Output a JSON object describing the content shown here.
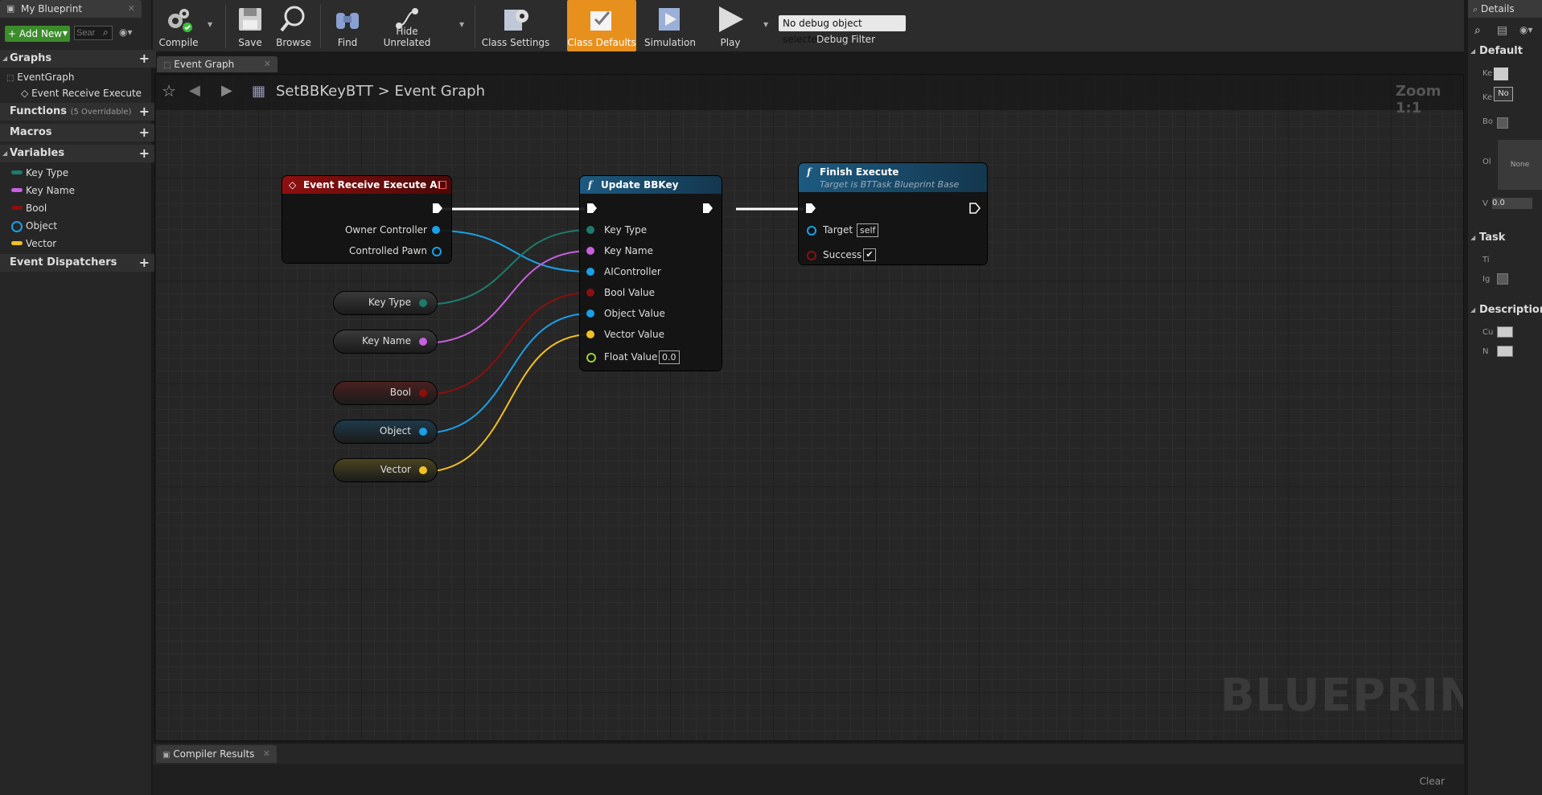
{
  "left_panel": {
    "tab_label": "My Blueprint",
    "add_new_label": "Add New",
    "search_placeholder": "Sear",
    "sections": {
      "graphs": "Graphs",
      "functions": "Functions",
      "functions_count": "(5 Overridable)",
      "macros": "Macros",
      "variables": "Variables",
      "event_dispatchers": "Event Dispatchers"
    },
    "graph_items": [
      "EventGraph",
      "Event Receive Execute"
    ],
    "variables": [
      {
        "name": "Key Type",
        "color": "#1f7a6c"
      },
      {
        "name": "Key Name",
        "color": "#c860e0"
      },
      {
        "name": "Bool",
        "color": "#8c0f0f"
      },
      {
        "name": "Object",
        "color": "#1aa0e6"
      },
      {
        "name": "Vector",
        "color": "#f2c020"
      }
    ]
  },
  "toolbar": {
    "compile": "Compile",
    "save": "Save",
    "browse": "Browse",
    "find": "Find",
    "hide_unrelated": "Hide Unrelated",
    "class_settings": "Class Settings",
    "class_defaults": "Class Defaults",
    "simulation": "Simulation",
    "play": "Play",
    "debug_select": "No debug object selected",
    "debug_filter": "Debug Filter"
  },
  "graph": {
    "tab_label": "Event Graph",
    "breadcrumb_root": "SetBBKeyBTT",
    "breadcrumb_current": "Event Graph",
    "zoom": "Zoom 1:1",
    "watermark": "BLUEPRINT"
  },
  "nodes": {
    "event": {
      "title": "Event Receive Execute AI",
      "pins": [
        "Owner Controller",
        "Controlled Pawn"
      ]
    },
    "update": {
      "title": "Update BBKey",
      "pins": [
        "Key Type",
        "Key Name",
        "AIController",
        "Bool Value",
        "Object Value",
        "Vector Value",
        "Float Value"
      ],
      "float_default": "0.0"
    },
    "finish": {
      "title": "Finish Execute",
      "subtitle": "Target is BTTask Blueprint Base",
      "target": "Target",
      "target_default": "self",
      "success": "Success"
    },
    "var_getters": [
      "Key Type",
      "Key Name",
      "Bool",
      "Object",
      "Vector"
    ]
  },
  "bottom": {
    "tab_label": "Compiler Results",
    "clear": "Clear"
  },
  "details": {
    "tab_label": "Details",
    "sections": [
      "Default",
      "Task",
      "Description"
    ],
    "row_labels": [
      "Ke",
      "Ke",
      "Bo",
      "Ol",
      "V",
      "Ti",
      "Ig",
      "Cu",
      "N"
    ],
    "no_label": "No",
    "none_label": "None",
    "vector_value": "0.0"
  },
  "colors": {
    "event_header": "#8e1010",
    "function_header": "#1d5a80",
    "accent_orange": "#e8901e",
    "exec_wire": "#ffffff"
  }
}
